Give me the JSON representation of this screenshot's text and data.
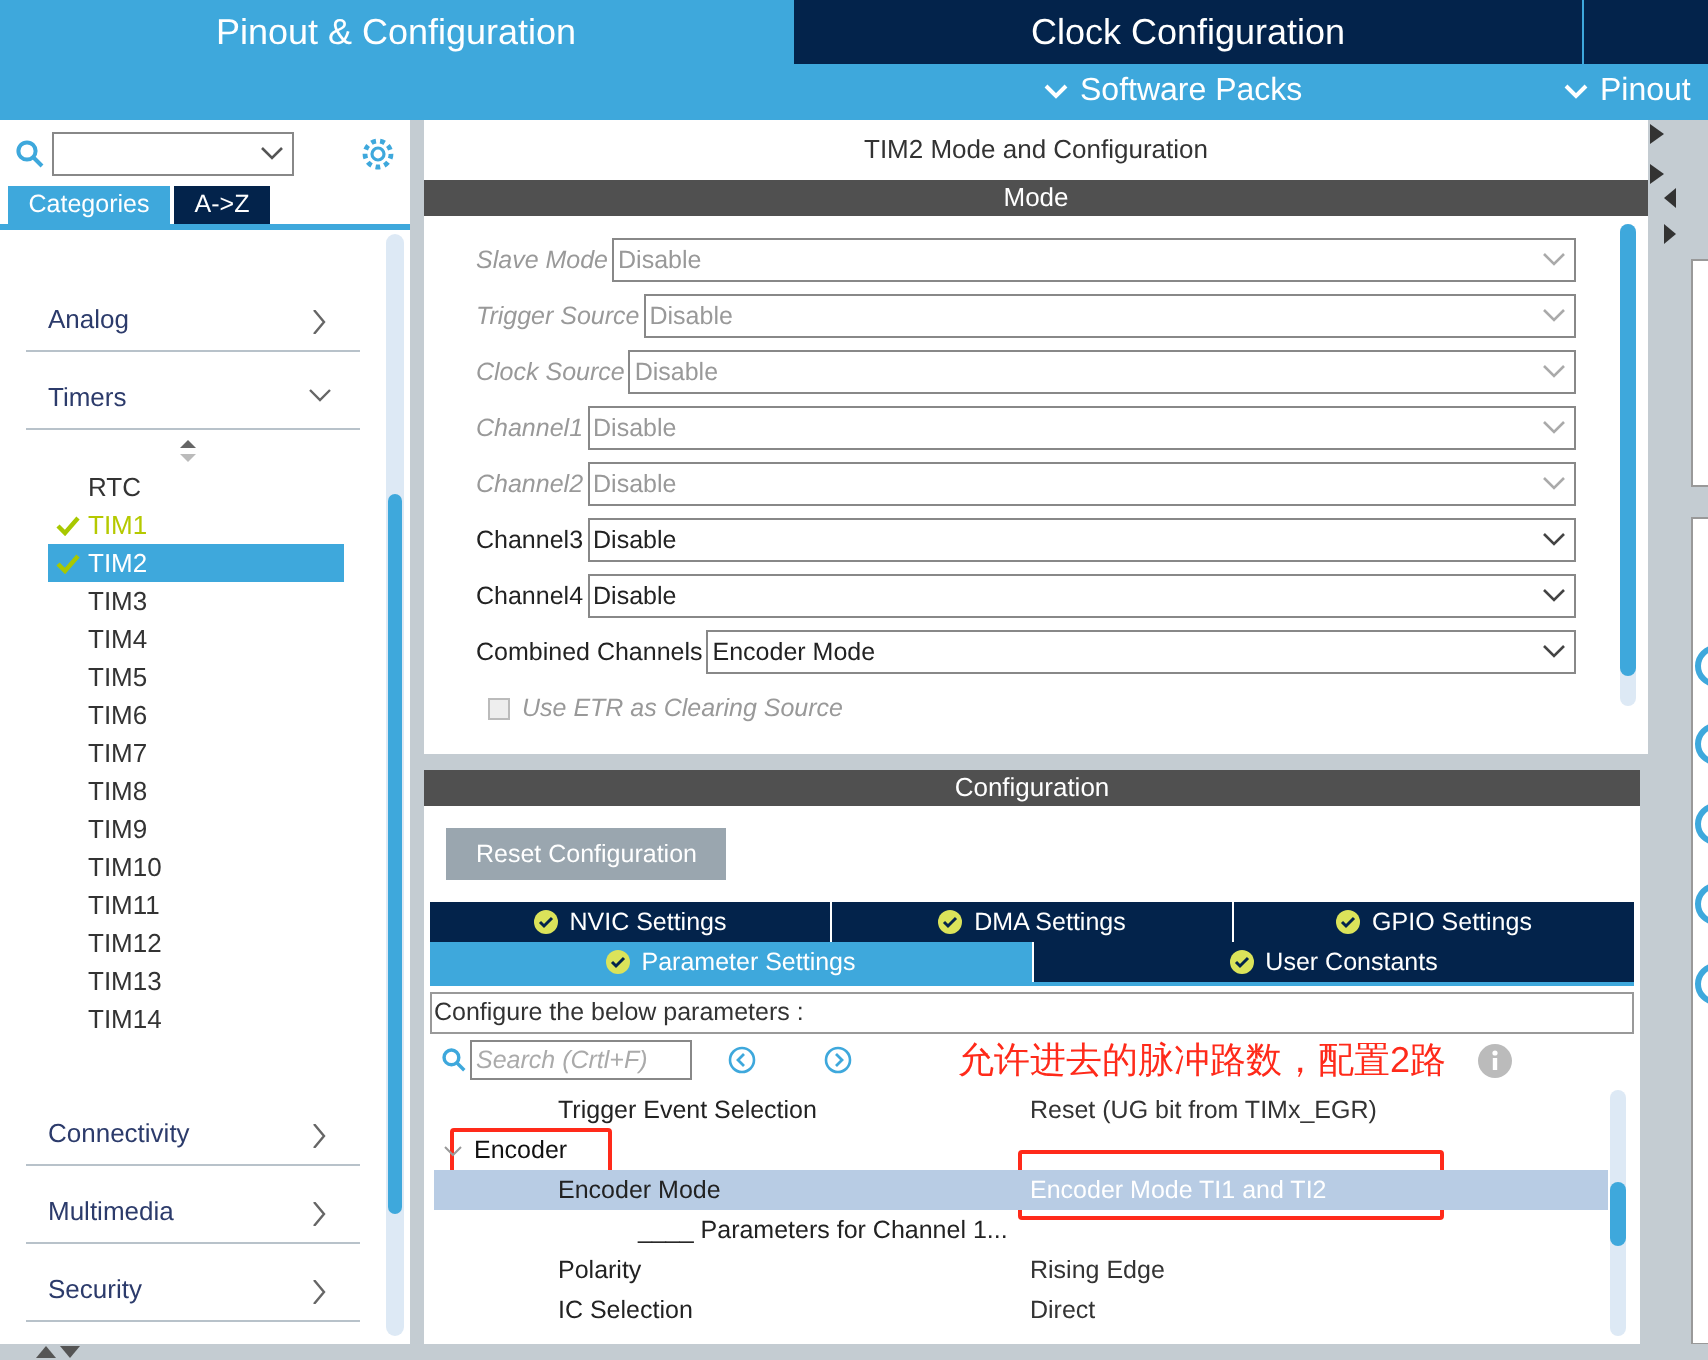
{
  "header": {
    "tabs": [
      {
        "label": "Pinout & Configuration",
        "selected": true
      },
      {
        "label": "Clock Configuration",
        "selected": false
      }
    ],
    "menus": [
      {
        "label": "Software Packs"
      },
      {
        "label": "Pinout"
      }
    ]
  },
  "sidebar": {
    "view_tabs": [
      {
        "label": "Categories",
        "selected": true
      },
      {
        "label": "A->Z",
        "selected": false
      }
    ],
    "categories": [
      {
        "label": "Analog",
        "expanded": false
      },
      {
        "label": "Timers",
        "expanded": true,
        "children": [
          {
            "label": "RTC",
            "configured": false,
            "selected": false
          },
          {
            "label": "TIM1",
            "configured": true,
            "selected": false
          },
          {
            "label": "TIM2",
            "configured": true,
            "selected": true
          },
          {
            "label": "TIM3",
            "configured": false,
            "selected": false
          },
          {
            "label": "TIM4",
            "configured": false,
            "selected": false
          },
          {
            "label": "TIM5",
            "configured": false,
            "selected": false
          },
          {
            "label": "TIM6",
            "configured": false,
            "selected": false
          },
          {
            "label": "TIM7",
            "configured": false,
            "selected": false
          },
          {
            "label": "TIM8",
            "configured": false,
            "selected": false
          },
          {
            "label": "TIM9",
            "configured": false,
            "selected": false
          },
          {
            "label": "TIM10",
            "configured": false,
            "selected": false
          },
          {
            "label": "TIM11",
            "configured": false,
            "selected": false
          },
          {
            "label": "TIM12",
            "configured": false,
            "selected": false
          },
          {
            "label": "TIM13",
            "configured": false,
            "selected": false
          },
          {
            "label": "TIM14",
            "configured": false,
            "selected": false
          }
        ]
      },
      {
        "label": "Connectivity",
        "expanded": false
      },
      {
        "label": "Multimedia",
        "expanded": false
      },
      {
        "label": "Security",
        "expanded": false
      }
    ]
  },
  "mode_panel": {
    "title": "TIM2 Mode and Configuration",
    "header": "Mode",
    "fields": [
      {
        "label": "Slave Mode",
        "value": "Disable",
        "disabled": true
      },
      {
        "label": "Trigger Source",
        "value": "Disable",
        "disabled": true
      },
      {
        "label": "Clock Source",
        "value": "Disable",
        "disabled": true
      },
      {
        "label": "Channel1",
        "value": "Disable",
        "disabled": true
      },
      {
        "label": "Channel2",
        "value": "Disable",
        "disabled": true
      },
      {
        "label": "Channel3",
        "value": "Disable",
        "disabled": false
      },
      {
        "label": "Channel4",
        "value": "Disable",
        "disabled": false
      },
      {
        "label": "Combined Channels",
        "value": "Encoder Mode",
        "disabled": false
      }
    ],
    "checkboxes": [
      {
        "label": "Use ETR as Clearing Source",
        "checked": false,
        "disabled": true
      }
    ]
  },
  "config_panel": {
    "header": "Configuration",
    "reset_button": "Reset Configuration",
    "tabs": [
      {
        "label": "NVIC Settings",
        "selected": false
      },
      {
        "label": "DMA Settings",
        "selected": false
      },
      {
        "label": "GPIO Settings",
        "selected": false
      },
      {
        "label": "Parameter Settings",
        "selected": true
      },
      {
        "label": "User Constants",
        "selected": false
      }
    ],
    "caption": "Configure the below parameters :",
    "search": {
      "placeholder": "Search (Crtl+F)"
    },
    "annotation": "允许进去的脉冲路数，配置2路",
    "parameters": [
      {
        "kind": "row",
        "name": "Trigger Event Selection",
        "value": "Reset (UG bit from TIMx_EGR)",
        "selected": false,
        "annotated": false
      },
      {
        "kind": "group",
        "name": "Encoder",
        "expanded": true,
        "annotated": true
      },
      {
        "kind": "row",
        "name": "Encoder Mode",
        "value": "Encoder Mode TI1 and TI2",
        "selected": true,
        "annotated": true
      },
      {
        "kind": "subheading",
        "name": "____ Parameters for Channel 1..."
      },
      {
        "kind": "row",
        "name": "Polarity",
        "value": "Rising Edge",
        "selected": false,
        "annotated": false
      },
      {
        "kind": "row",
        "name": "IC Selection",
        "value": "Direct",
        "selected": false,
        "annotated": false
      }
    ]
  }
}
